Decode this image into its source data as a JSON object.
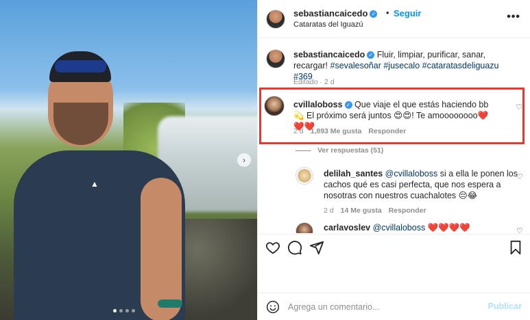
{
  "post": {
    "username": "sebastiancaicedo",
    "follow_label": "Seguir",
    "separator": "•",
    "location": "Cataratas del Iguazú",
    "more_label": "•••",
    "photo_brand_logo": "▲",
    "carousel_next": "›"
  },
  "caption": {
    "username": "sebastiancaicedo",
    "text": "Fluir, limpiar, purificar, sanar, recargar!",
    "hashtags": "#sevalesoñar #jusecalo #cataratasdeliguazu #369",
    "meta": "Editado · 2 d"
  },
  "comments": [
    {
      "username": "cvillaloboss",
      "text": "Que viaje el que estás haciendo bb 💫 El próximo será juntos 😍😍! Te amoooooooo❤️❤️❤️",
      "time": "2 d",
      "likes": "1,893 Me gusta",
      "reply_label": "Responder",
      "highlighted": true
    },
    {
      "username": "delilah_santes",
      "mention": "@cvillaloboss",
      "text": "si a ella le ponen los cachos qué es casi perfecta, que nos espera a nosotras con nuestros cuachalotes 😔😂",
      "time": "2 d",
      "likes": "14 Me gusta",
      "reply_label": "Responder"
    },
    {
      "username": "carlavoslev",
      "mention": "@cvillaloboss",
      "text": "❤️❤️❤️❤️"
    }
  ],
  "view_replies": "Ver respuestas (51)",
  "add_comment": {
    "placeholder": "Agrega un comentario...",
    "post_label": "Publicar"
  },
  "colors": {
    "accent_blue": "#0095f6",
    "highlight_red": "#e5382e",
    "muted": "#8e8e8e"
  }
}
